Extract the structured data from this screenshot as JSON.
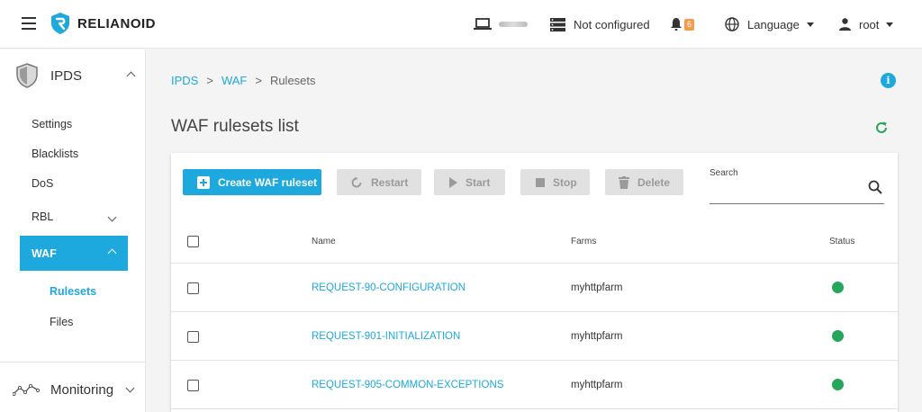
{
  "header": {
    "brand": "RELIANOID",
    "cluster_status": "Not configured",
    "notification_count": "6",
    "language_label": "Language",
    "user": "root"
  },
  "sidebar": {
    "sections": [
      {
        "label": "IPDS"
      },
      {
        "label": "Monitoring"
      }
    ],
    "items": [
      {
        "label": "Settings"
      },
      {
        "label": "Blacklists"
      },
      {
        "label": "DoS"
      },
      {
        "label": "RBL"
      },
      {
        "label": "WAF"
      },
      {
        "label": "Rulesets"
      },
      {
        "label": "Files"
      }
    ]
  },
  "breadcrumb": [
    "IPDS",
    "WAF",
    "Rulesets"
  ],
  "breadcrumb_sep": ">",
  "page_title": "WAF rulesets list",
  "toolbar": {
    "create": "Create WAF ruleset",
    "restart": "Restart",
    "start": "Start",
    "stop": "Stop",
    "delete": "Delete"
  },
  "search": {
    "label": "Search",
    "value": ""
  },
  "table": {
    "columns": [
      "Name",
      "Farms",
      "Status"
    ],
    "rows": [
      {
        "name": "REQUEST-90-CONFIGURATION",
        "farms": "myhttpfarm",
        "status": "up"
      },
      {
        "name": "REQUEST-901-INITIALIZATION",
        "farms": "myhttpfarm",
        "status": "up"
      },
      {
        "name": "REQUEST-905-COMMON-EXCEPTIONS",
        "farms": "myhttpfarm",
        "status": "up"
      }
    ]
  },
  "colors": {
    "accent": "#1da9dd",
    "status_up": "#26a65b",
    "badge": "#f39c4a",
    "refresh": "#26a65b"
  }
}
